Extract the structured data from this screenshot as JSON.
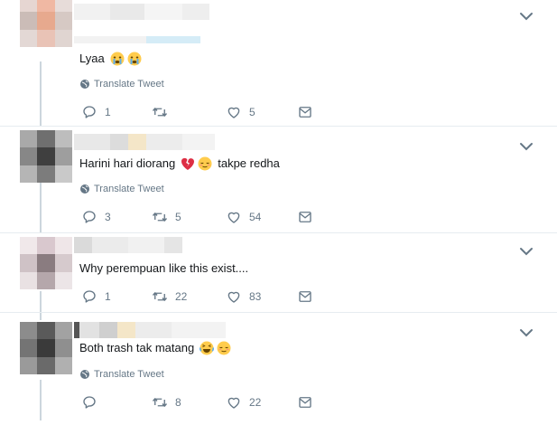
{
  "tweets": [
    {
      "text": "Lyaa",
      "emojis": [
        "crying-face",
        "crying-face"
      ],
      "translate_label": "Translate Tweet",
      "replies": "1",
      "retweets": "",
      "likes": "5"
    },
    {
      "text_before": "Harini hari diorang",
      "emojis": [
        "broken-heart",
        "relieved-face"
      ],
      "text_after": "takpe redha",
      "translate_label": "Translate Tweet",
      "replies": "3",
      "retweets": "5",
      "likes": "54"
    },
    {
      "text": "Why perempuan like this exist....",
      "replies": "1",
      "retweets": "22",
      "likes": "83"
    },
    {
      "text": "Both trash tak matang",
      "emojis": [
        "tears-of-joy",
        "relieved-face"
      ],
      "translate_label": "Translate Tweet",
      "replies": "",
      "retweets": "8",
      "likes": "22"
    }
  ],
  "icons": {
    "reply": "reply-icon",
    "retweet": "retweet-icon",
    "like": "heart-icon",
    "dm": "envelope-icon",
    "globe": "globe-icon",
    "menu": "chevron-down-icon"
  },
  "colors": {
    "text": "#14171a",
    "secondary": "#657786",
    "divider": "#e6ecf0",
    "thread": "#ccd6dd"
  }
}
